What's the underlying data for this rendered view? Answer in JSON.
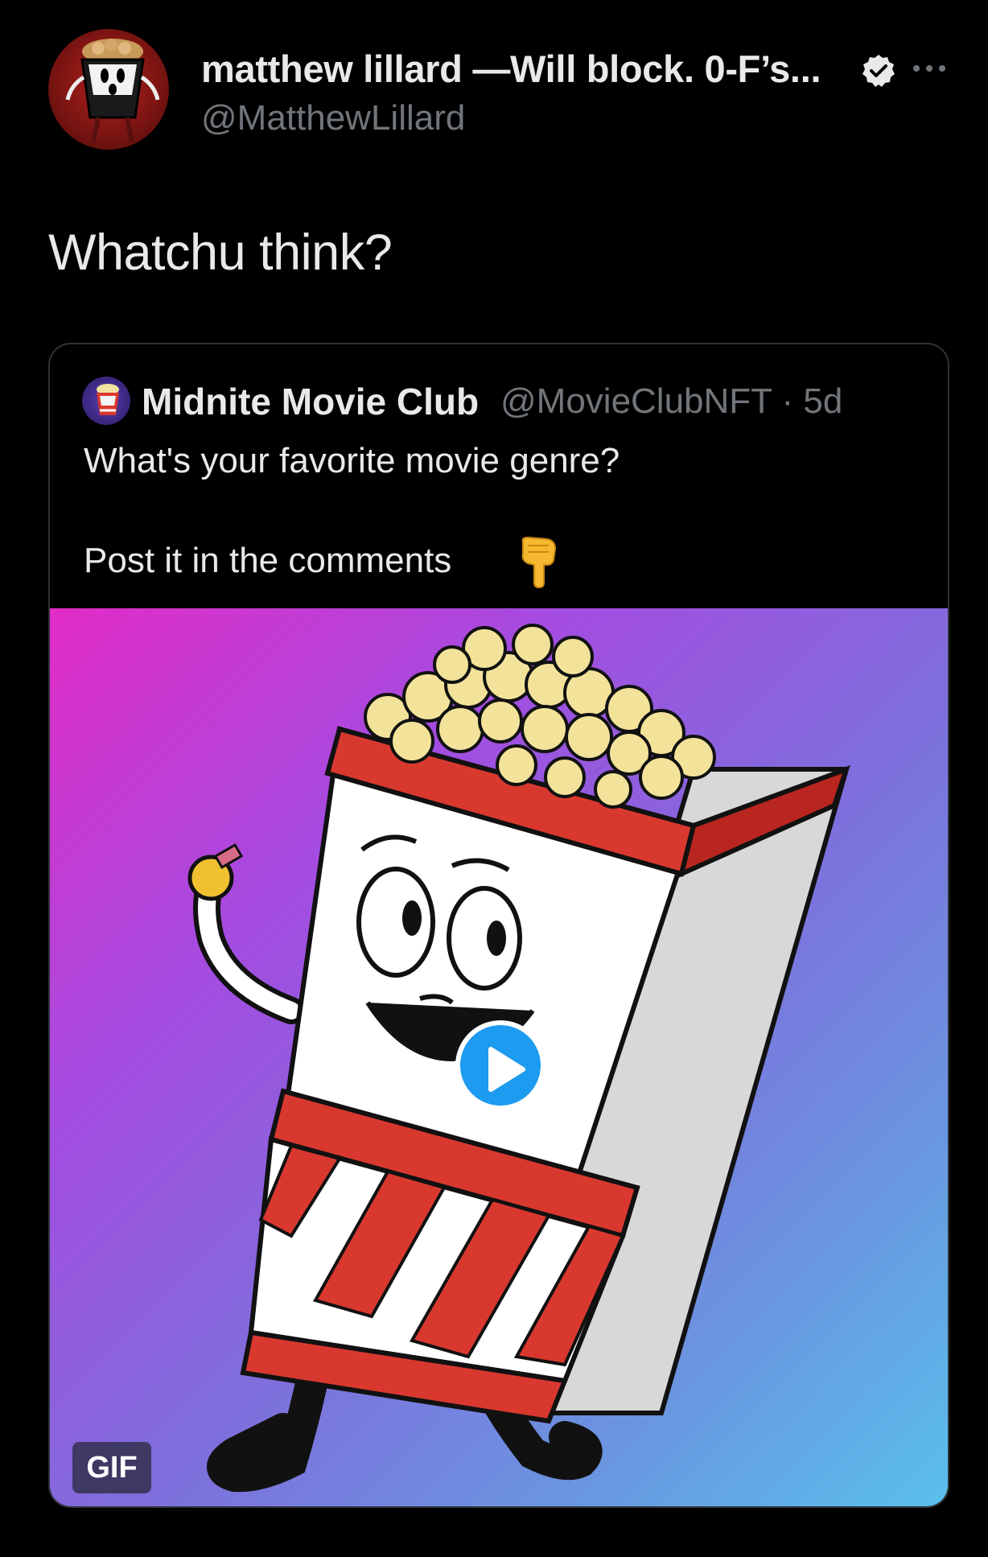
{
  "tweet": {
    "author": {
      "display_name": "matthew lillard —Will block. 0-F’s...",
      "handle": "@MatthewLillard",
      "verified": true,
      "avatar_icon": "ghostface-popcorn-avatar"
    },
    "text": "Whatchu think?",
    "more_icon": "more-horizontal-icon"
  },
  "quote": {
    "author": {
      "display_name": "Midnite Movie Club",
      "handle_time": "@MovieClubNFT · 5d",
      "avatar_icon": "popcorn-avatar"
    },
    "text_line_1": "What's your favorite movie genre?",
    "text_line_2": "Post it in the comments",
    "emoji_icon": "backhand-index-pointing-down-icon",
    "media": {
      "type": "gif",
      "badge": "GIF",
      "play_icon": "play-icon",
      "description_icon": "popcorn-mascot-illustration"
    }
  },
  "colors": {
    "background": "#000000",
    "text_primary": "#e7e9ea",
    "text_secondary": "#71767b",
    "border": "#2f3336",
    "accent": "#1d9bf0"
  }
}
